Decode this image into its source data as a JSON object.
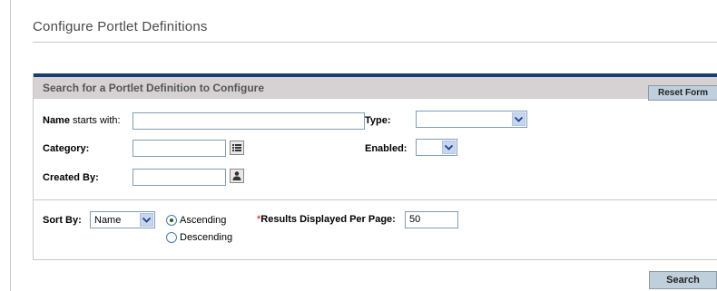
{
  "page": {
    "title": "Configure Portlet Definitions"
  },
  "panel": {
    "title": "Search for a Portlet Definition to Configure",
    "reset_label": "Reset Form"
  },
  "fields": {
    "name": {
      "label_bold": "Name",
      "label_rest": " starts with:",
      "value": ""
    },
    "type": {
      "label": "Type:",
      "value": ""
    },
    "category": {
      "label": "Category:",
      "value": ""
    },
    "enabled": {
      "label": "Enabled:",
      "value": ""
    },
    "created_by": {
      "label": "Created By:",
      "value": ""
    }
  },
  "sort": {
    "label": "Sort By:",
    "value": "Name",
    "ascending_label": "Ascending",
    "descending_label": "Descending",
    "selected": "ascending"
  },
  "results": {
    "required_mark": "*",
    "label": "Results Displayed Per Page:",
    "value": "50"
  },
  "actions": {
    "search_label": "Search"
  }
}
